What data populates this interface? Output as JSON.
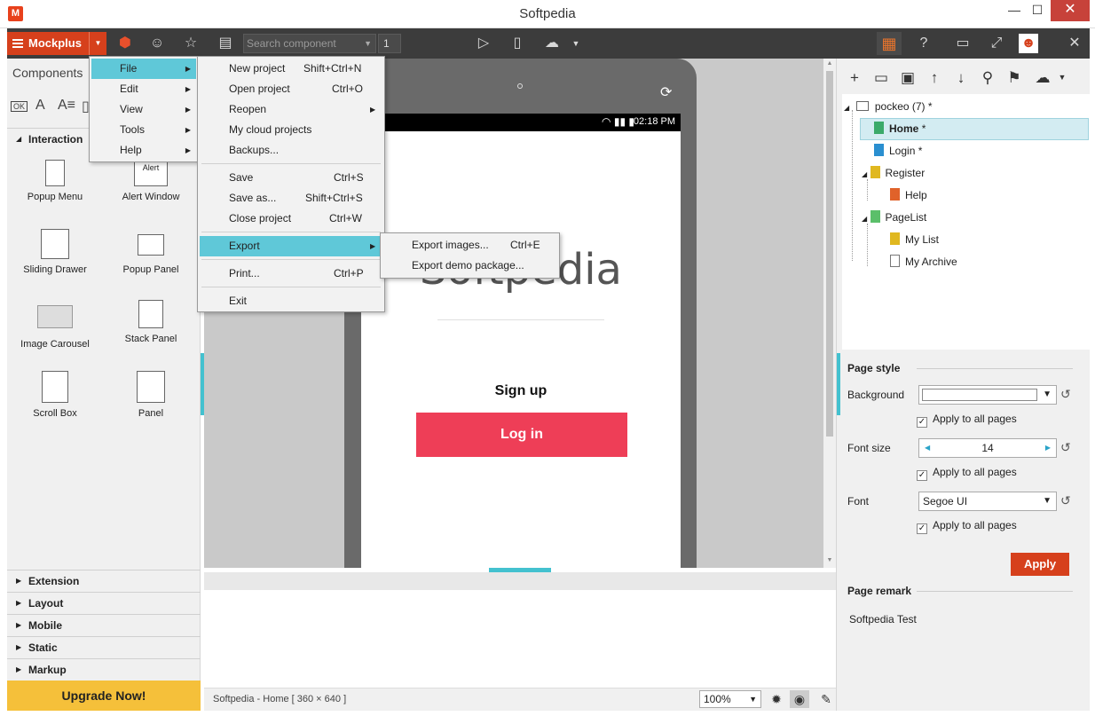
{
  "window": {
    "title": "Softpedia",
    "app_icon": "M",
    "minimize": "—",
    "maximize": "☐",
    "close": "✕"
  },
  "toolbar": {
    "brand": "Mockplus",
    "search_placeholder": "Search component",
    "page_number": "1"
  },
  "left_panel": {
    "tab": "Components",
    "sections": [
      "Interaction",
      "Extension",
      "Layout",
      "Mobile",
      "Static",
      "Markup"
    ],
    "components": [
      {
        "label": "Popup Menu"
      },
      {
        "label": "Alert Window",
        "thumb_text": "Alert"
      },
      {
        "label": "Sliding Drawer"
      },
      {
        "label": "Popup Panel"
      },
      {
        "label": "Image Carousel"
      },
      {
        "label": "Stack Panel"
      },
      {
        "label": "Scroll Box"
      },
      {
        "label": "Panel"
      }
    ],
    "upgrade": "Upgrade Now!"
  },
  "main_menu": {
    "items": [
      "File",
      "Edit",
      "View",
      "Tools",
      "Help"
    ]
  },
  "file_menu": {
    "items": [
      {
        "label": "New project",
        "shortcut": "Shift+Ctrl+N"
      },
      {
        "label": "Open project",
        "shortcut": "Ctrl+O"
      },
      {
        "label": "Reopen",
        "shortcut": ""
      },
      {
        "label": "My cloud projects",
        "shortcut": ""
      },
      {
        "label": "Backups...",
        "shortcut": ""
      },
      {
        "label": "Save",
        "shortcut": "Ctrl+S"
      },
      {
        "label": "Save as...",
        "shortcut": "Shift+Ctrl+S"
      },
      {
        "label": "Close project",
        "shortcut": "Ctrl+W"
      },
      {
        "label": "Export",
        "shortcut": ""
      },
      {
        "label": "Print...",
        "shortcut": "Ctrl+P"
      },
      {
        "label": "Exit",
        "shortcut": ""
      }
    ]
  },
  "export_menu": {
    "items": [
      {
        "label": "Export images...",
        "shortcut": "Ctrl+E"
      },
      {
        "label": "Export demo package...",
        "shortcut": ""
      }
    ]
  },
  "phone": {
    "time": "02:18 PM",
    "logo_text": "Softpedia",
    "signup": "Sign up",
    "login": "Log in"
  },
  "statusbar": {
    "page_info": "Softpedia - Home [ 360 × 640 ]",
    "zoom": "100%"
  },
  "tree": {
    "root": "pockeo (7)",
    "pages": [
      {
        "label": "Home",
        "mark": "*",
        "color": "#3aaa6a"
      },
      {
        "label": "Login",
        "mark": "*",
        "color": "#2a8fd0"
      },
      {
        "label": "Register",
        "mark": "",
        "color": "#e0b820"
      },
      {
        "label": "Help",
        "mark": "",
        "color": "#e0622a"
      },
      {
        "label": "PageList",
        "mark": "",
        "color": "#5bbf6a"
      },
      {
        "label": "My List",
        "mark": "",
        "color": "#e0b820"
      },
      {
        "label": "My Archive",
        "mark": "",
        "color": "#ffffff"
      }
    ],
    "root_mark": "*"
  },
  "page_style": {
    "heading": "Page style",
    "background_label": "Background",
    "apply_all": "Apply to all pages",
    "font_size_label": "Font size",
    "font_size": "14",
    "font_label": "Font",
    "font": "Segoe UI",
    "apply_button": "Apply"
  },
  "page_remark": {
    "heading": "Page remark",
    "text": "Softpedia Test"
  },
  "colors": {
    "accent": "#d6401c",
    "highlight": "#5fc8d8",
    "login_button": "#ee3e57",
    "upgrade": "#f5c03a"
  }
}
